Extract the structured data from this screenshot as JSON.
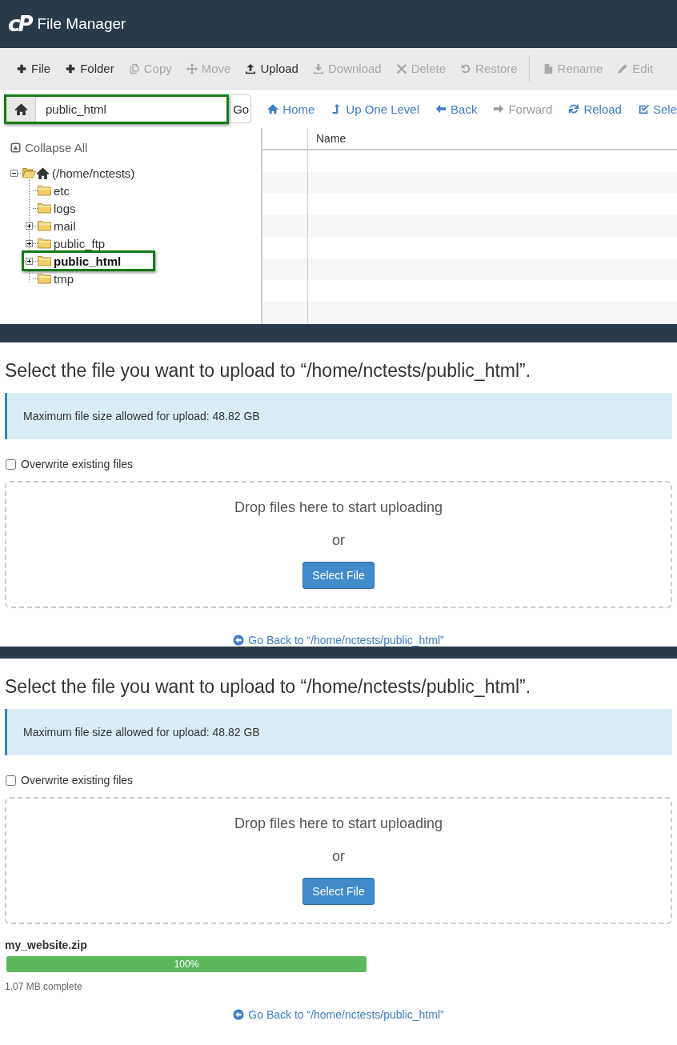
{
  "app": {
    "logo": "cP",
    "title": "File Manager"
  },
  "toolbar": {
    "groups": [
      [
        {
          "label": "File",
          "disabled": false
        },
        {
          "label": "Folder",
          "disabled": false
        },
        {
          "label": "Copy",
          "disabled": true
        },
        {
          "label": "Move",
          "disabled": true
        },
        {
          "label": "Upload",
          "disabled": false
        },
        {
          "label": "Download",
          "disabled": true
        },
        {
          "label": "Delete",
          "disabled": true
        },
        {
          "label": "Restore",
          "disabled": true
        }
      ],
      [
        {
          "label": "Rename",
          "disabled": true
        },
        {
          "label": "Edit",
          "disabled": true
        }
      ]
    ]
  },
  "path_bar": {
    "value": "public_html",
    "highlighted": true,
    "go": "Go"
  },
  "nav": [
    {
      "label": "Home",
      "disabled": false
    },
    {
      "label": "Up One Level",
      "disabled": false
    },
    {
      "label": "Back",
      "disabled": false
    },
    {
      "label": "Forward",
      "disabled": true
    },
    {
      "label": "Reload",
      "disabled": false
    },
    {
      "label": "Sele",
      "disabled": false
    }
  ],
  "tree": {
    "collapse_all": "Collapse All",
    "root": {
      "label": "(/home/nctests)",
      "kind": "branch",
      "expanded": true,
      "selected": false,
      "highlighted": false,
      "children": [
        {
          "label": "etc",
          "kind": "leaf",
          "selected": false,
          "highlighted": false
        },
        {
          "label": "logs",
          "kind": "leaf",
          "selected": false,
          "highlighted": false
        },
        {
          "label": "mail",
          "kind": "branch",
          "expanded": false,
          "selected": false,
          "highlighted": false
        },
        {
          "label": "public_ftp",
          "kind": "branch",
          "expanded": false,
          "selected": false,
          "highlighted": false
        },
        {
          "label": "public_html",
          "kind": "branch",
          "expanded": false,
          "selected": true,
          "highlighted": true
        },
        {
          "label": "tmp",
          "kind": "leaf",
          "selected": false,
          "highlighted": false
        }
      ]
    }
  },
  "table": {
    "columns": [
      "Name"
    ]
  },
  "uploads": [
    {
      "title": "Select the file you want to upload to “/home/nctests/public_html”.",
      "alert": "Maximum file size allowed for upload: 48.82 GB",
      "overwrite": {
        "label": "Overwrite existing files",
        "checked": false
      },
      "drop_text": "Drop files here to start uploading",
      "or": "or",
      "select_button": "Select File",
      "go_back": "Go Back to “/home/nctests/public_html”"
    },
    {
      "title": "Select the file you want to upload to “/home/nctests/public_html”.",
      "alert": "Maximum file size allowed for upload: 48.82 GB",
      "overwrite": {
        "label": "Overwrite existing files",
        "checked": false
      },
      "drop_text": "Drop files here to start uploading",
      "or": "or",
      "select_button": "Select File",
      "files": [
        {
          "name": "my_website.zip",
          "level": 1,
          "percent": "100%",
          "status": "1.07 MB complete"
        }
      ],
      "go_back": "Go Back to “/home/nctests/public_html”"
    }
  ]
}
